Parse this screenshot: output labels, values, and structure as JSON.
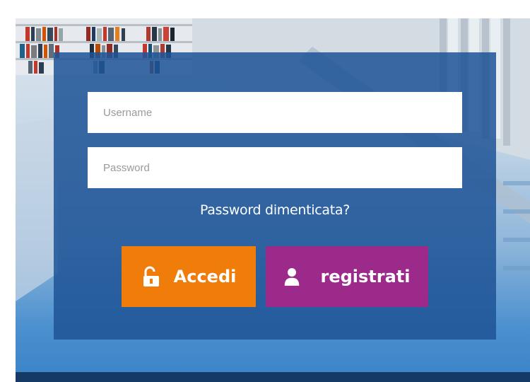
{
  "login_form": {
    "username": {
      "placeholder": "Username",
      "value": ""
    },
    "password": {
      "placeholder": "Password",
      "value": ""
    },
    "forgot_password_label": "Password dimenticata?",
    "login_button": {
      "label": "Accedi",
      "icon": "unlock-icon"
    },
    "register_button": {
      "label": "registrati",
      "icon": "user-icon"
    }
  },
  "colors": {
    "panel": "#1e5496",
    "login_button": "#f07d0a",
    "register_button": "#9c2a8a",
    "footer_bar": "#153a66"
  }
}
